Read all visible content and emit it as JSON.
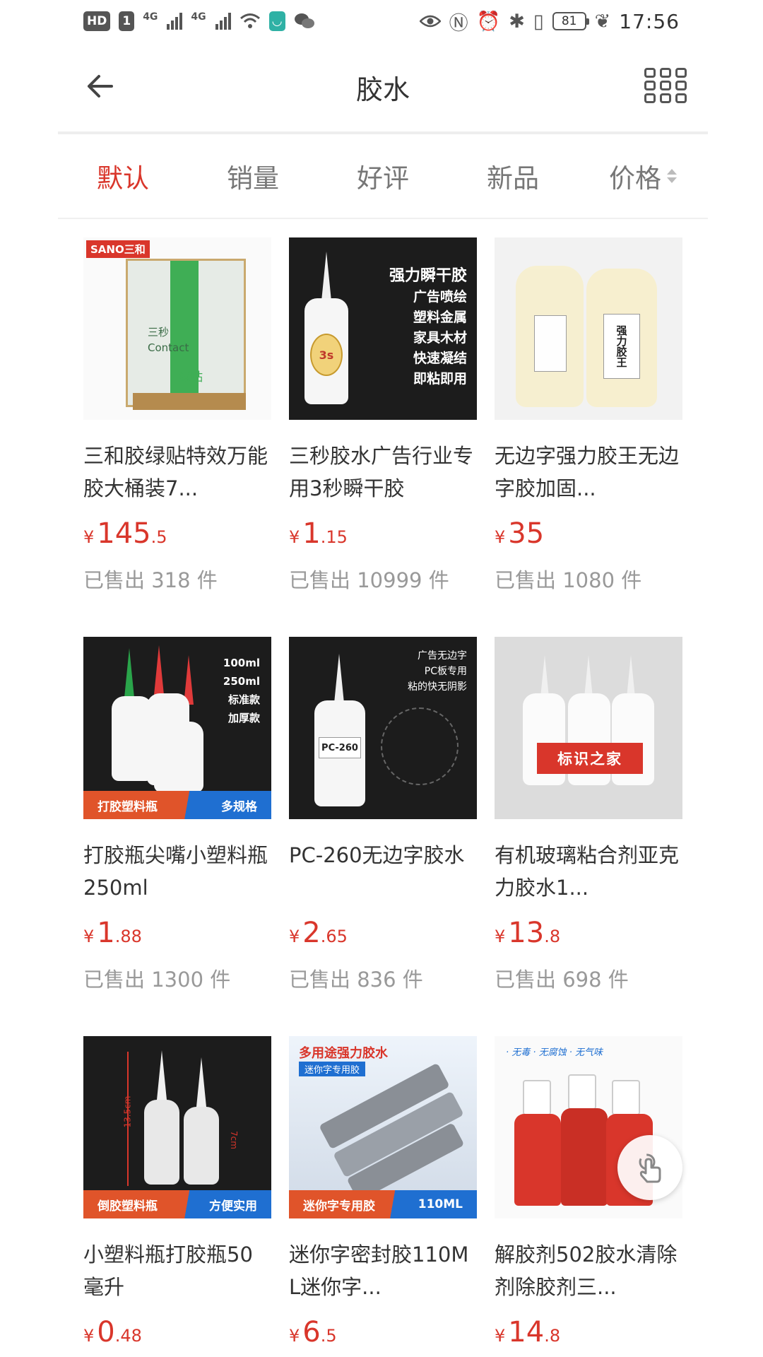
{
  "status_bar": {
    "hd_label": "HD",
    "sim_label": "1",
    "net1": "4G",
    "net2": "4G",
    "battery": "81",
    "time": "17:56"
  },
  "header": {
    "title": "胶水",
    "back_icon": "arrow-left-icon",
    "menu_icon": "grid-icon"
  },
  "sort_tabs": [
    {
      "label": "默认",
      "active": true
    },
    {
      "label": "销量",
      "active": false
    },
    {
      "label": "好评",
      "active": false
    },
    {
      "label": "新品",
      "active": false
    },
    {
      "label": "价格",
      "active": false
    }
  ],
  "products": [
    {
      "name": "三和胶绿贴特效万能胶大桶装7...",
      "currency": "¥",
      "price_int": "145",
      "price_dec": ".5",
      "sold": "已售出 318 件",
      "thumb": {
        "brand": "SANO三和",
        "lines": [
          "三秒",
          "Contact",
          "绿贴"
        ]
      }
    },
    {
      "name": "三秒胶水广告行业专用3秒瞬干胶",
      "currency": "¥",
      "price_int": "1",
      "price_dec": ".15",
      "sold": "已售出 10999 件",
      "thumb": {
        "title": "强力瞬干胶",
        "lines": [
          "广告喷绘",
          "塑料金属",
          "家具木材",
          "快速凝结",
          "即粘即用"
        ],
        "badge": "3s"
      }
    },
    {
      "name": "无边字强力胶王无边字胶加固...",
      "currency": "¥",
      "price_int": "35",
      "price_dec": "",
      "sold": "已售出 1080 件",
      "thumb": {
        "label": "强力胶王"
      }
    },
    {
      "name": "打胶瓶尖嘴小塑料瓶250ml",
      "currency": "¥",
      "price_int": "1",
      "price_dec": ".88",
      "sold": "已售出 1300 件",
      "thumb": {
        "lines": [
          "100ml",
          "250ml",
          "标准款",
          "加厚款"
        ],
        "ribbon_left": "打胶塑料瓶",
        "ribbon_right": "多规格"
      }
    },
    {
      "name": "PC-260无边字胶水",
      "currency": "¥",
      "price_int": "2",
      "price_dec": ".65",
      "sold": "已售出 836 件",
      "thumb": {
        "lines": [
          "广告无边字",
          "PC板专用",
          "粘的快无阴影"
        ],
        "label": "PC-260"
      }
    },
    {
      "name": "有机玻璃粘合剂亚克力胶水1...",
      "currency": "¥",
      "price_int": "13",
      "price_dec": ".8",
      "sold": "已售出 698 件",
      "thumb": {
        "banner": "标识之家"
      }
    },
    {
      "name": "小塑料瓶打胶瓶50毫升",
      "currency": "¥",
      "price_int": "0",
      "price_dec": ".48",
      "sold": "",
      "thumb": {
        "ribbon_left": "倒胶塑料瓶",
        "ribbon_right": "方便实用",
        "dim1": "13.5cm",
        "dim2": "7cm"
      }
    },
    {
      "name": "迷你字密封胶110ML迷你字...",
      "currency": "¥",
      "price_int": "6",
      "price_dec": ".5",
      "sold": "",
      "thumb": {
        "title": "多用途强力胶水",
        "subtitle": "迷你字专用胶",
        "ribbon_left": "迷你字专用胶",
        "ribbon_right": "110ML"
      }
    },
    {
      "name": "解胶剂502胶水清除剂除胶剂三...",
      "currency": "¥",
      "price_int": "14",
      "price_dec": ".8",
      "sold": "",
      "thumb": {
        "tags": "· 无毒  · 无腐蚀  · 无气味"
      }
    }
  ],
  "fab": {
    "icon": "hand-pointer-icon"
  },
  "colors": {
    "accent": "#d9362b",
    "muted": "#999999",
    "tab_inactive": "#777777"
  }
}
